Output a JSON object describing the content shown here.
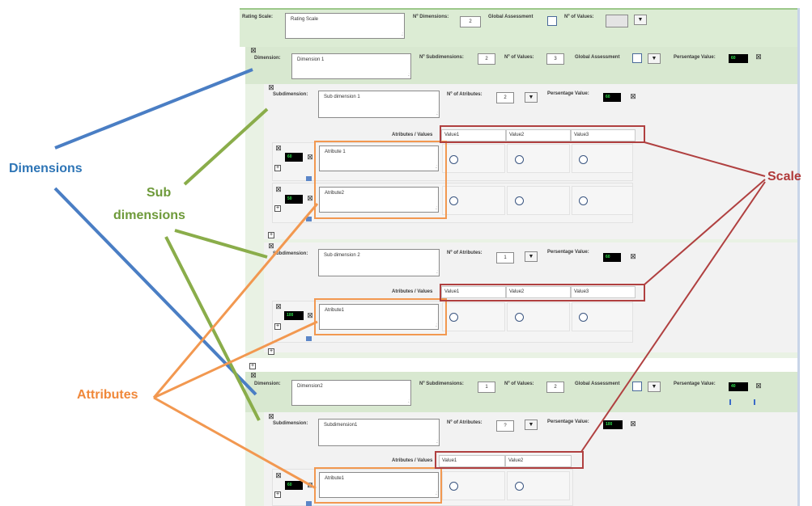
{
  "rating_scale": {
    "label": "Rating Scale:",
    "name": "Rating Scale",
    "n_dimensions_label": "Nº Dimensions:",
    "n_dimensions": "2",
    "global_assessment_label": "Global Assessment",
    "n_values_label": "Nº of Values:",
    "n_values": ""
  },
  "dimensions": [
    {
      "label": "Dimension:",
      "name": "Dimension 1",
      "n_sub_label": "Nº Subdimensions:",
      "n_sub": "2",
      "n_values_label": "Nº of Values:",
      "n_values": "3",
      "global_label": "Global Assessment",
      "pct_label": "Persentage Value:",
      "pct": "60",
      "subdimensions": [
        {
          "label": "Subdimension:",
          "name": "Sub dimension 1",
          "n_attr_label": "Nº of Atributes:",
          "n_attr": "2",
          "pct_label": "Persentage Value:",
          "pct": "60",
          "attr_values_label": "Atributes / Values",
          "values": [
            "Value1",
            "Value2",
            "Value3"
          ],
          "attributes": [
            {
              "pct": "60",
              "name": "Atribute 1"
            },
            {
              "pct": "50",
              "name": "Atribute2"
            }
          ]
        },
        {
          "label": "Subdimension:",
          "name": "Sub dimension 2",
          "n_attr_label": "Nº of Atributes:",
          "n_attr": "1",
          "pct_label": "Persentage Value:",
          "pct": "60",
          "attr_values_label": "Atributes / Values",
          "values": [
            "Value1",
            "Value2",
            "Value3"
          ],
          "attributes": [
            {
              "pct": "100",
              "name": "Atribute1"
            }
          ]
        }
      ]
    },
    {
      "label": "Dimension:",
      "name": "Dimension2",
      "n_sub_label": "Nº Subdimensions:",
      "n_sub": "1",
      "n_values_label": "Nº of Values:",
      "n_values": "2",
      "global_label": "Global Assessment",
      "pct_label": "Persentage Value:",
      "pct": "40",
      "subdimensions": [
        {
          "label": "Subdimension:",
          "name": "Subdimension1",
          "n_attr_label": "Nº of Atributes:",
          "n_attr": "?",
          "pct_label": "Persentage Value:",
          "pct": "100",
          "attr_values_label": "Atributes / Values",
          "values": [
            "Value1",
            "Value2"
          ],
          "attributes": [
            {
              "pct": "60",
              "name": "Atribute1"
            }
          ]
        }
      ]
    }
  ],
  "annotations": {
    "dimensions": "Dimensions",
    "sub_line1": "Sub",
    "sub_line2": "dimensions",
    "attributes": "Attributes",
    "scale": "Scale"
  },
  "colors": {
    "dimensions": "#2e75b6",
    "subdimensions": "#6e9a3a",
    "attributes": "#f0883a",
    "scale": "#b03a3a",
    "panel": "#d8ead0"
  },
  "icons": {
    "close": "close-icon",
    "expand": "plus-icon",
    "collapse": "minus-icon",
    "dropdown": "dropdown-icon",
    "edit": "pencil-icon"
  }
}
